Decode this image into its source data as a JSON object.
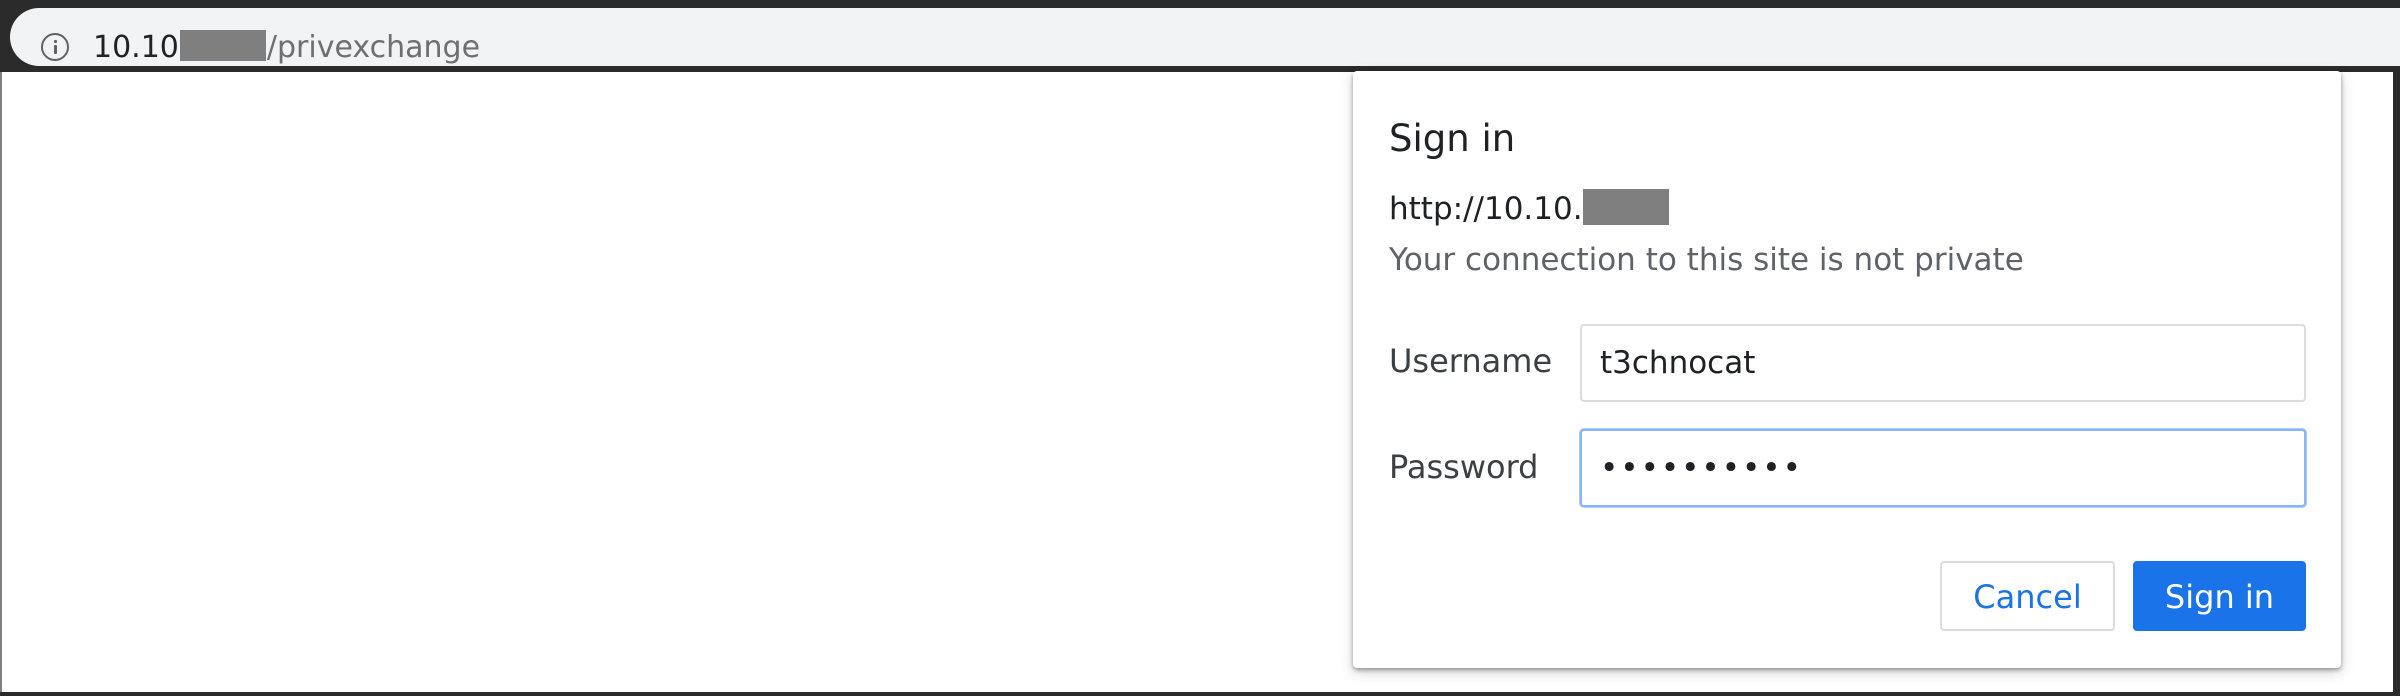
{
  "omnibox": {
    "icon": "info-icon",
    "host_prefix": "10.10",
    "path": "/privexchange"
  },
  "dialog": {
    "title": "Sign in",
    "origin_prefix": "http://10.10.",
    "warning": "Your connection to this site is not private",
    "username_label": "Username",
    "username_value": "t3chnocat",
    "password_label": "Password",
    "password_value": "••••••••••",
    "cancel_label": "Cancel",
    "signin_label": "Sign in"
  },
  "colors": {
    "accent": "#1a73e8",
    "redaction": "#7f7f7f",
    "frame": "#2b2b2b"
  }
}
